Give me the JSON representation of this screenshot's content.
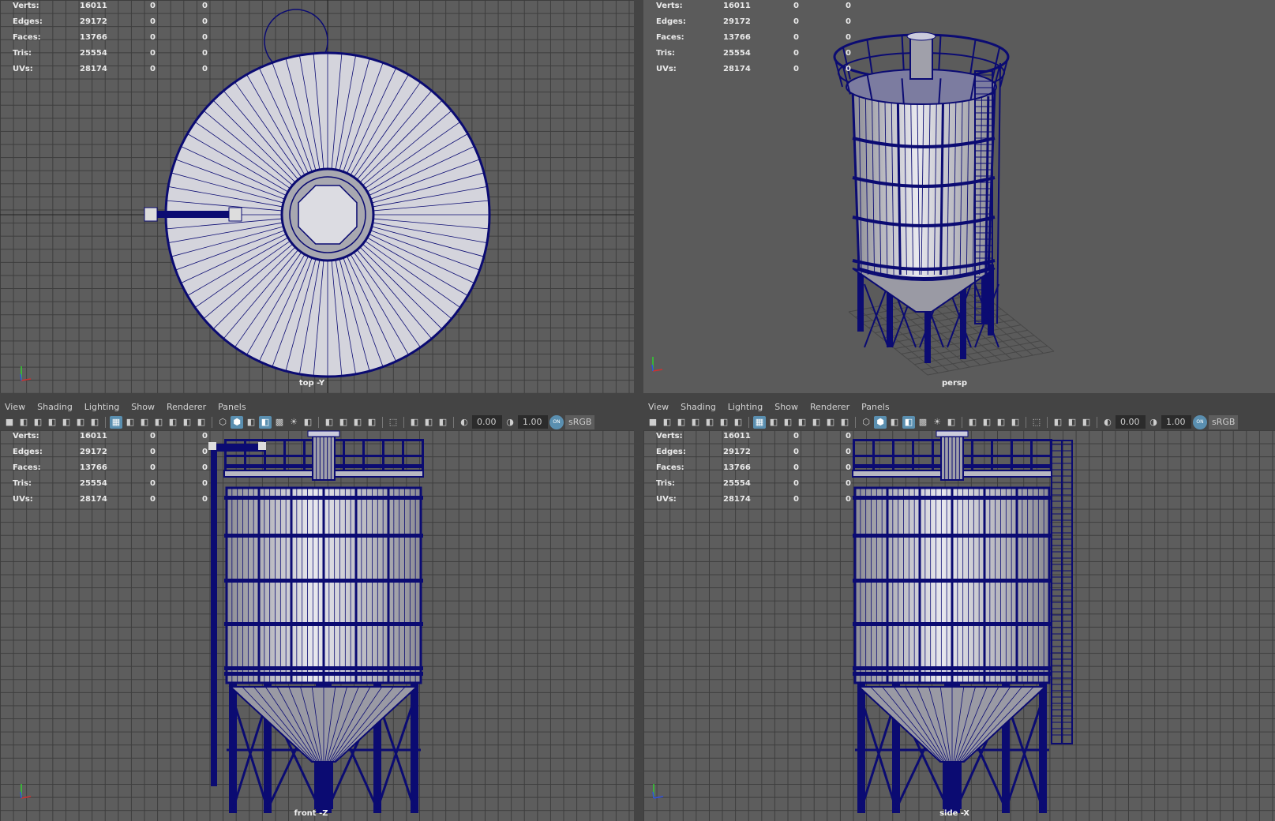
{
  "hud": {
    "rows": [
      {
        "label": "Verts:",
        "value": "16011",
        "sel": "0",
        "uv": "0"
      },
      {
        "label": "Edges:",
        "value": "29172",
        "sel": "0",
        "uv": "0"
      },
      {
        "label": "Faces:",
        "value": "13766",
        "sel": "0",
        "uv": "0"
      },
      {
        "label": "Tris:",
        "value": "25554",
        "sel": "0",
        "uv": "0"
      },
      {
        "label": "UVs:",
        "value": "28174",
        "sel": "0",
        "uv": "0"
      }
    ]
  },
  "viewports": {
    "top": {
      "label": "top -Y"
    },
    "persp": {
      "label": "persp"
    },
    "front": {
      "label": "front -Z"
    },
    "side": {
      "label": "side -X"
    }
  },
  "menu": [
    "View",
    "Shading",
    "Lighting",
    "Show",
    "Renderer",
    "Panels"
  ],
  "toolbar": {
    "icons": [
      "camera-icon",
      "lock-camera-icon",
      "camera-attributes-icon",
      "bookmark-icon",
      "grease-pencil-icon",
      "pan-zoom-icon",
      "paint-icon",
      "|",
      "grid-icon",
      "film-gate-icon",
      "resolution-gate-icon",
      "gate-mask-icon",
      "field-chart-icon",
      "safe-action-icon",
      "safe-title-icon",
      "|",
      "wireframe-icon",
      "smooth-shade-icon",
      "default-material-icon",
      "wireframe-on-shaded-icon",
      "xray-icon",
      "lights-icon",
      "shadows-icon",
      "|",
      "ambient-occlusion-icon",
      "motion-blur-icon",
      "anti-alias-icon",
      "depth-of-field-icon",
      "|",
      "isolate-select-icon",
      "|",
      "xray-joints-icon",
      "xray-active-icon",
      "backface-icon",
      "|"
    ],
    "active": [
      "grid-icon",
      "smooth-shade-icon",
      "wireframe-on-shaded-icon"
    ],
    "exposure": "0.00",
    "gamma": "1.00",
    "color_mgmt": "ON",
    "view_transform": "sRGB"
  },
  "colors": {
    "wireframe": "#0b0b72",
    "shaded": "#c9c9cf",
    "grid_bg": "#5d5d5d",
    "persp_bg": "#5b5b5b",
    "axis_x": "#d03030",
    "axis_y": "#30d030",
    "axis_z": "#3050e0"
  }
}
